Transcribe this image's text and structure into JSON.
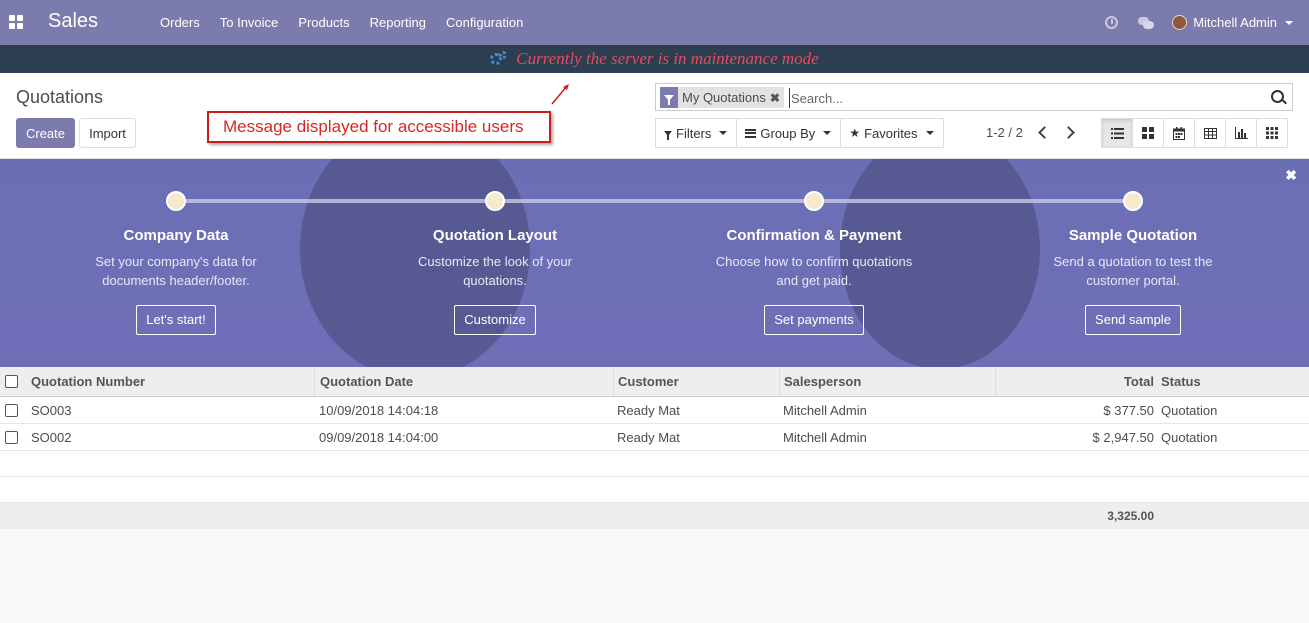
{
  "navbar": {
    "app_name": "Sales",
    "menu": [
      "Orders",
      "To Invoice",
      "Products",
      "Reporting",
      "Configuration"
    ],
    "user_name": "Mitchell Admin"
  },
  "maintenance": {
    "message": "Currently the server is in maintenance mode"
  },
  "control_panel": {
    "breadcrumb": "Quotations",
    "create_label": "Create",
    "import_label": "Import",
    "annotation": "Message displayed for accessible users",
    "search": {
      "facet_label": "My Quotations",
      "placeholder": "Search..."
    },
    "filters_label": "Filters",
    "group_by_label": "Group By",
    "favorites_label": "Favorites",
    "pager": "1-2 / 2"
  },
  "banner": {
    "steps": [
      {
        "title": "Company Data",
        "desc_1": "Set your company's data for",
        "desc_2": "documents header/footer.",
        "button": "Let's start!"
      },
      {
        "title": "Quotation Layout",
        "desc_1": "Customize the look of your",
        "desc_2": "quotations.",
        "button": "Customize"
      },
      {
        "title": "Confirmation & Payment",
        "desc_1": "Choose how to confirm quotations",
        "desc_2": "and get paid.",
        "button": "Set payments"
      },
      {
        "title": "Sample Quotation",
        "desc_1": "Send a quotation to test the",
        "desc_2": "customer portal.",
        "button": "Send sample"
      }
    ]
  },
  "table": {
    "columns": [
      "Quotation Number",
      "Quotation Date",
      "Customer",
      "Salesperson",
      "Total",
      "Status"
    ],
    "rows": [
      {
        "number": "SO003",
        "date": "10/09/2018 14:04:18",
        "customer": "Ready Mat",
        "salesperson": "Mitchell Admin",
        "total": "$ 377.50",
        "status": "Quotation"
      },
      {
        "number": "SO002",
        "date": "09/09/2018 14:04:00",
        "customer": "Ready Mat",
        "salesperson": "Mitchell Admin",
        "total": "$ 2,947.50",
        "status": "Quotation"
      }
    ],
    "sum_total": "3,325.00"
  },
  "colors": {
    "brand": "#7c7bad",
    "maintenance_bg": "#2c3e50",
    "maintenance_text": "#e84a5f",
    "annotation": "#d62828"
  }
}
